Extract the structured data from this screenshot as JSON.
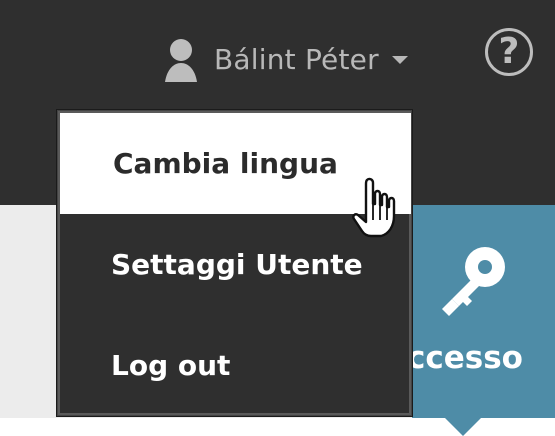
{
  "header": {
    "user_name": "Bálint Péter",
    "help_label": "?",
    "colors": {
      "background": "#2f2f2f",
      "text": "#b8b8b8"
    }
  },
  "dropdown": {
    "items": [
      {
        "label": "Cambia lingua",
        "active": true
      },
      {
        "label": "Settaggi Utente",
        "active": false
      },
      {
        "label": "Log out",
        "active": false
      }
    ],
    "colors": {
      "background": "#2f2f2f",
      "active_background": "#ffffff",
      "active_text": "#2b2b2b",
      "text": "#ffffff"
    }
  },
  "tile": {
    "label": "ccesso",
    "icon": "key-icon",
    "color": "#4e8ca7"
  },
  "cursor": {
    "icon": "hand-pointer-icon"
  }
}
